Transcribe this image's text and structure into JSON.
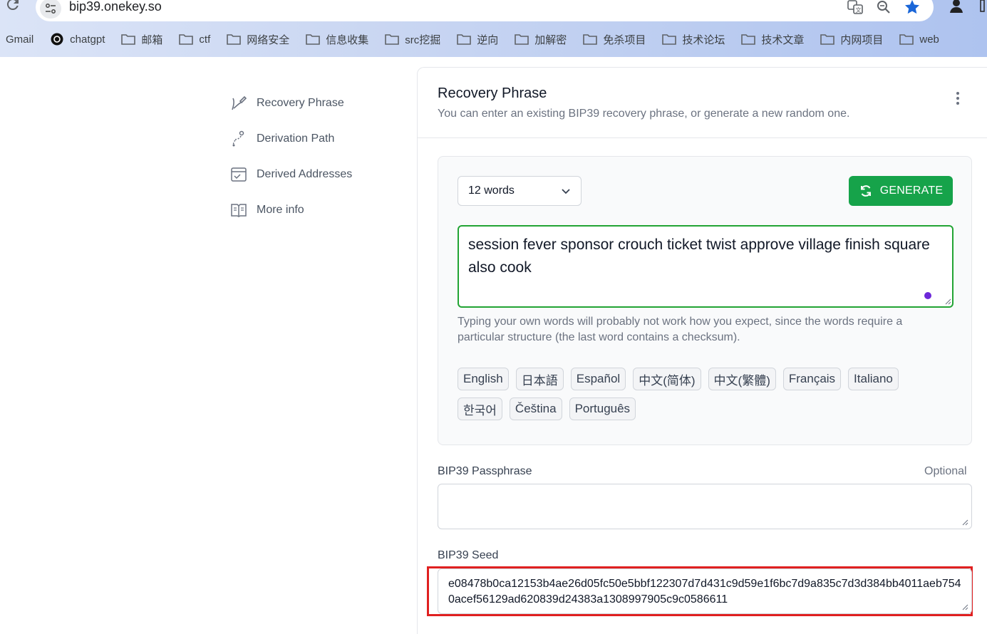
{
  "browser": {
    "url": "bip39.onekey.so",
    "bookmarks": [
      {
        "label": "Gmail",
        "icon": "none"
      },
      {
        "label": "chatgpt",
        "icon": "chatgpt-icon"
      },
      {
        "label": "邮箱",
        "icon": "folder-icon"
      },
      {
        "label": "ctf",
        "icon": "folder-icon"
      },
      {
        "label": "网络安全",
        "icon": "folder-icon"
      },
      {
        "label": "信息收集",
        "icon": "folder-icon"
      },
      {
        "label": "src挖掘",
        "icon": "folder-icon"
      },
      {
        "label": "逆向",
        "icon": "folder-icon"
      },
      {
        "label": "加解密",
        "icon": "folder-icon"
      },
      {
        "label": "免杀项目",
        "icon": "folder-icon"
      },
      {
        "label": "技术论坛",
        "icon": "folder-icon"
      },
      {
        "label": "技术文章",
        "icon": "folder-icon"
      },
      {
        "label": "内网项目",
        "icon": "folder-icon"
      },
      {
        "label": "web",
        "icon": "folder-icon"
      }
    ]
  },
  "nav": {
    "items": [
      {
        "label": "Recovery Phrase",
        "icon": "pen-icon"
      },
      {
        "label": "Derivation Path",
        "icon": "path-icon"
      },
      {
        "label": "Derived Addresses",
        "icon": "checklist-icon"
      },
      {
        "label": "More info",
        "icon": "book-icon"
      }
    ]
  },
  "card": {
    "title": "Recovery Phrase",
    "subtitle": "You can enter an existing BIP39 recovery phrase, or generate a new random one.",
    "word_count": "12 words",
    "generate_label": "GENERATE",
    "mnemonic": "session fever sponsor crouch ticket twist approve village finish square also cook",
    "hint": "Typing your own words will probably not work how you expect, since the words require a particular structure (the last word contains a checksum).",
    "languages": [
      "English",
      "日本語",
      "Español",
      "中文(简体)",
      "中文(繁體)",
      "Français",
      "Italiano",
      "한국어",
      "Čeština",
      "Português"
    ],
    "passphrase_label": "BIP39 Passphrase",
    "passphrase_optional": "Optional",
    "passphrase_value": "",
    "seed_label": "BIP39 Seed",
    "seed_value": "e08478b0ca12153b4ae26d05fc50e5bbf122307d7d431c9d59e1f6bc7d9a835c7d3d384bb4011aeb7540acef56129ad620839d24383a1308997905c9c0586611"
  },
  "colors": {
    "accent_green": "#16a34a",
    "highlight_red": "#e02020",
    "dot_purple": "#6d28d9"
  }
}
